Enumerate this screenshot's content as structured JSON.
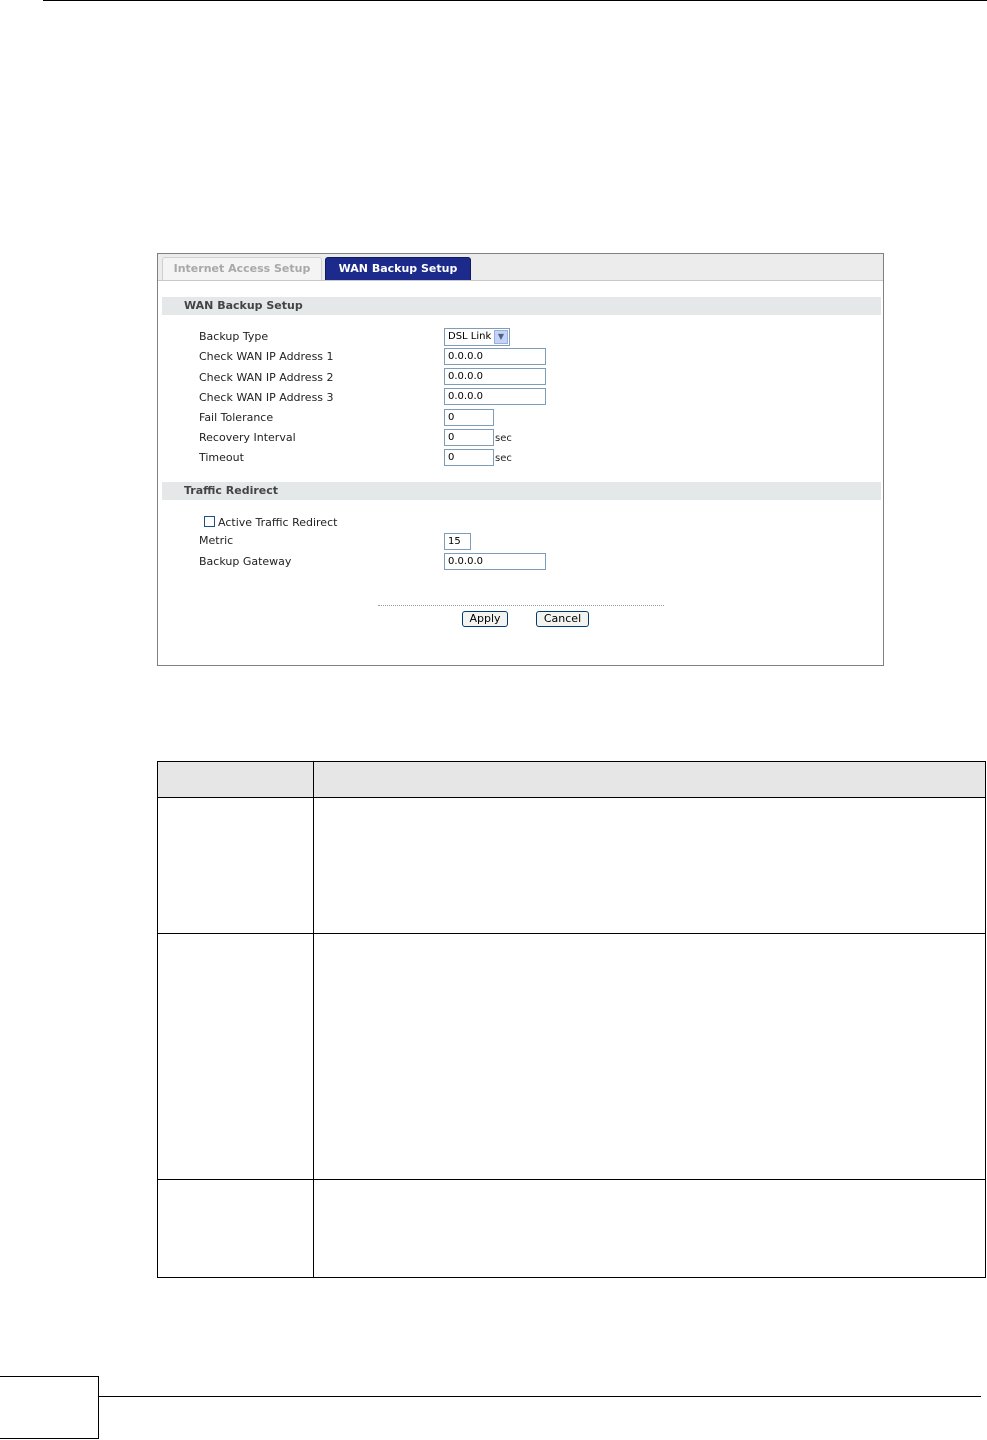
{
  "tabs": {
    "internet_access": "Internet Access Setup",
    "wan_backup": "WAN Backup Setup"
  },
  "wan_backup_section": {
    "title": "WAN Backup Setup",
    "backup_type_label": "Backup Type",
    "backup_type_value": "DSL Link",
    "check_ip1_label": "Check WAN IP Address  1",
    "check_ip1_value": "0.0.0.0",
    "check_ip2_label": "Check WAN IP Address  2",
    "check_ip2_value": "0.0.0.0",
    "check_ip3_label": "Check WAN IP Address  3",
    "check_ip3_value": "0.0.0.0",
    "fail_tolerance_label": "Fail Tolerance",
    "fail_tolerance_value": "0",
    "recovery_interval_label": "Recovery Interval",
    "recovery_interval_value": "0",
    "recovery_interval_unit": "sec",
    "timeout_label": "Timeout",
    "timeout_value": "0",
    "timeout_unit": "sec"
  },
  "traffic_redirect_section": {
    "title": "Traffic Redirect",
    "active_label": "Active Traffic Redirect",
    "active_checked": false,
    "metric_label": "Metric",
    "metric_value": "15",
    "backup_gateway_label": "Backup Gateway",
    "backup_gateway_value": "0.0.0.0"
  },
  "buttons": {
    "apply": "Apply",
    "cancel": "Cancel"
  }
}
